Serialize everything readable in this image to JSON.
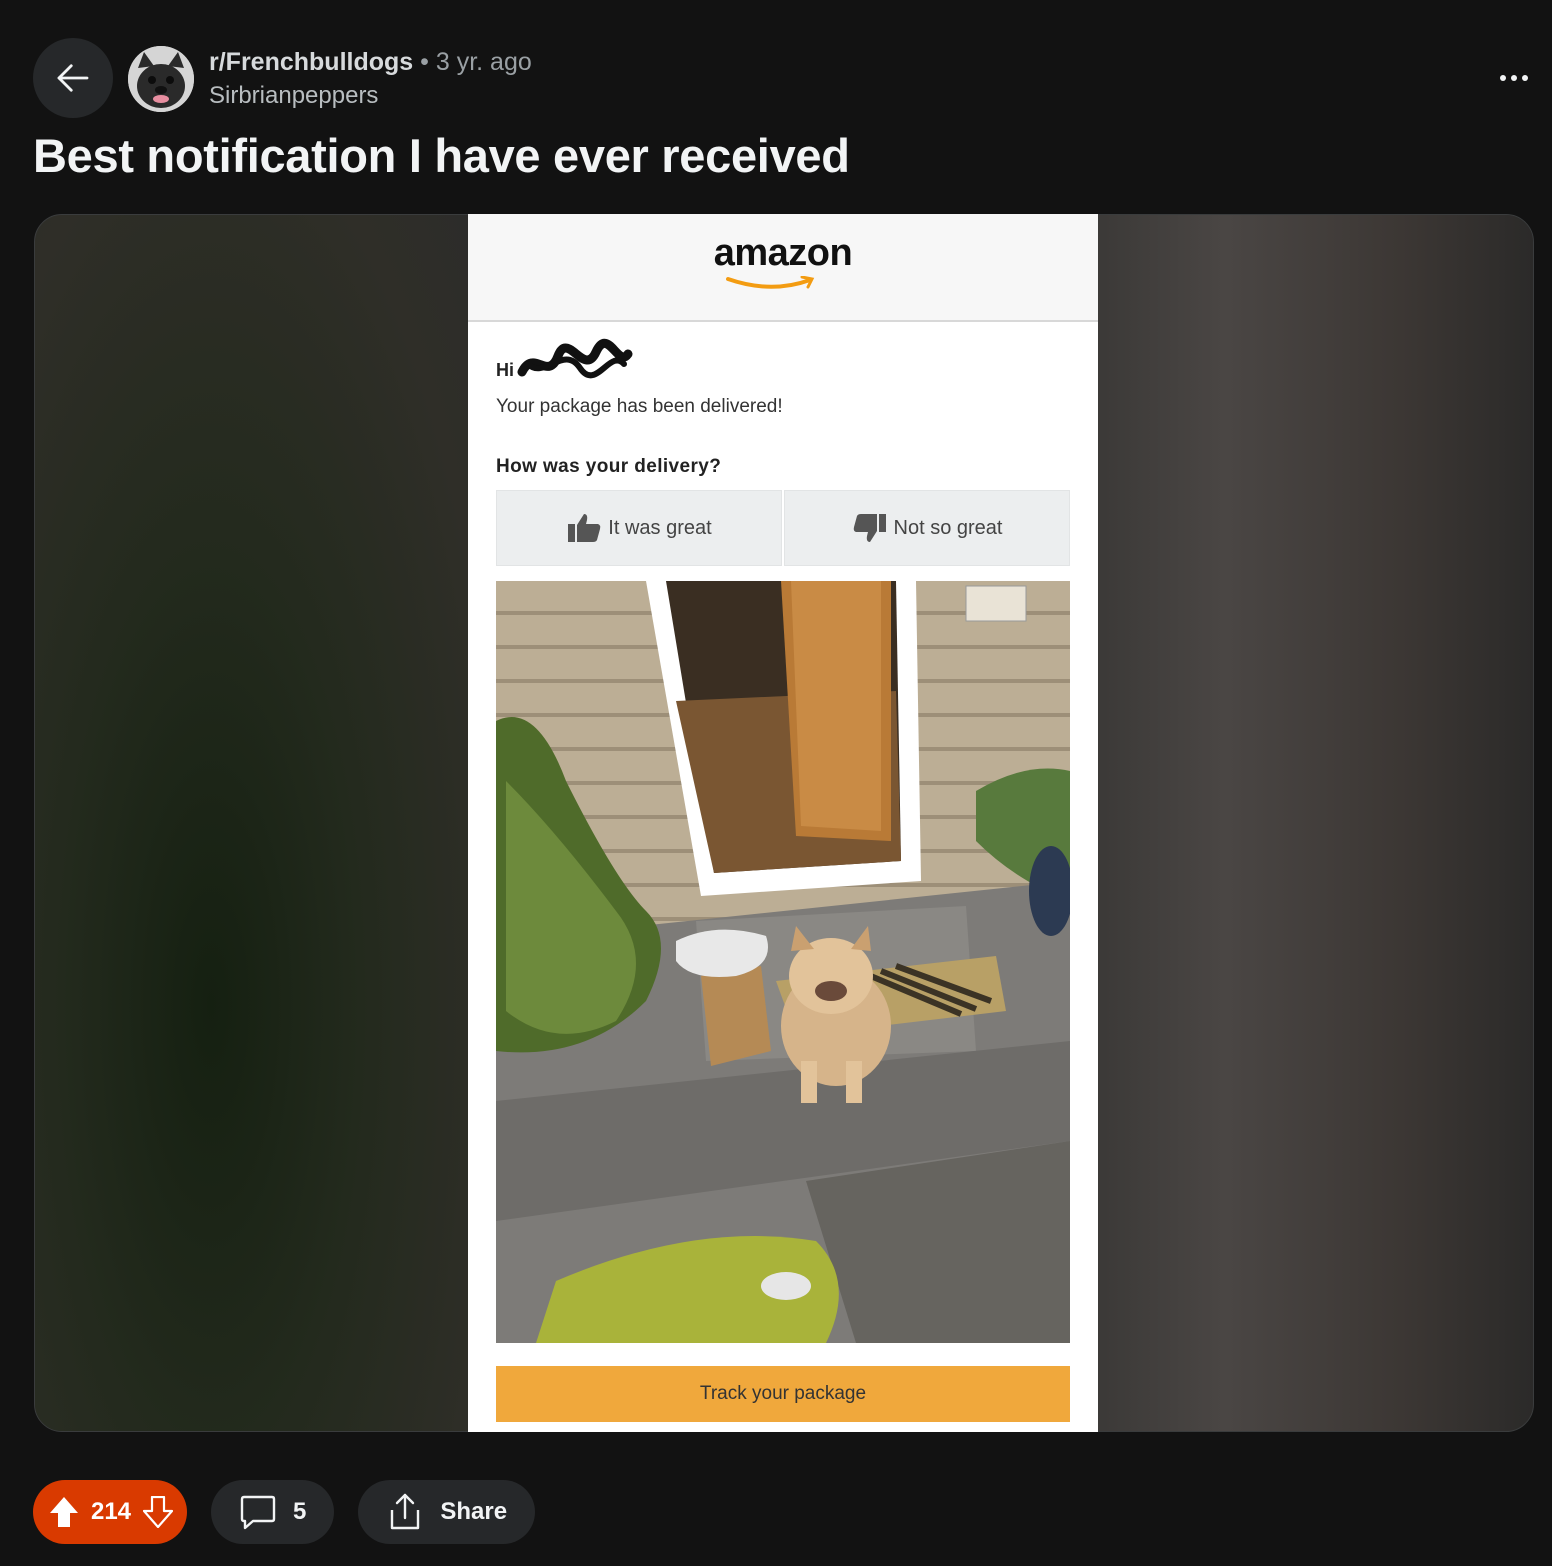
{
  "post": {
    "subreddit": "r/Frenchbulldogs",
    "separator": "•",
    "age": "3 yr. ago",
    "author": "Sirbrianpeppers",
    "title": "Best notification I have ever received"
  },
  "email": {
    "brand": "amazon",
    "greeting": "Hi",
    "delivered_text": "Your package has been delivered!",
    "question": "How was your delivery?",
    "great_label": "It was great",
    "not_great_label": "Not so great",
    "track_label": "Track your package"
  },
  "actions": {
    "vote_count": "214",
    "comment_count": "5",
    "share_label": "Share"
  },
  "icons": {
    "back": "arrow-left-icon",
    "more": "more-horizontal-icon",
    "upvote": "upvote-icon",
    "downvote": "downvote-icon",
    "comment": "comment-icon",
    "share": "share-icon"
  },
  "colors": {
    "background": "#121212",
    "upvote_active": "#d93a00",
    "pill": "#26282a",
    "amazon_button": "#f0a83c"
  }
}
